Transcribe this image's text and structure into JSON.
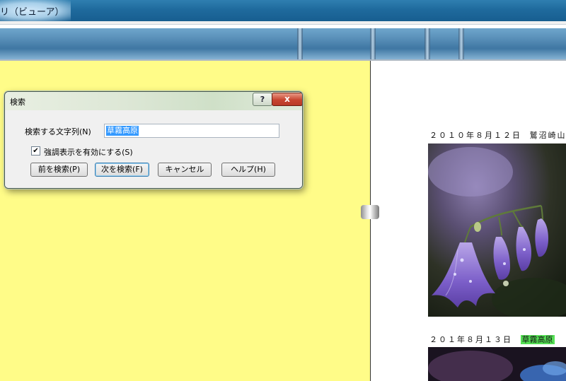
{
  "window": {
    "title": "リ（ビューア）"
  },
  "right_pane": {
    "entries": [
      {
        "date": "２０１０年８月１２日",
        "place": "鷲沼崎山",
        "highlighted": false
      },
      {
        "date": "２０１年８月１３日",
        "place": "草霧高原",
        "highlighted": true
      }
    ]
  },
  "dialog": {
    "title": "検索",
    "help_glyph": "?",
    "close_glyph": "x",
    "search_label": "検索する文字列(N)",
    "search_value": "草霧高原",
    "checkbox_label": "強調表示を有効にする(S)",
    "checkbox_checked": true,
    "checkbox_glyph": "✔",
    "buttons": {
      "prev": "前を検索(P)",
      "next": "次を検索(F)",
      "cancel": "キャンセル",
      "help": "ヘルプ(H)"
    }
  },
  "colors": {
    "left_pane_bg": "#fffc88",
    "highlight": "#55e055",
    "selection": "#3399ff"
  }
}
